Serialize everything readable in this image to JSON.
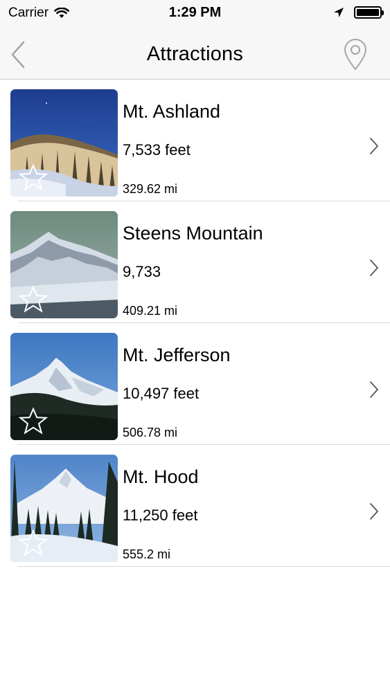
{
  "status_bar": {
    "carrier": "Carrier",
    "time": "1:29 PM"
  },
  "nav": {
    "title": "Attractions",
    "back_icon": "chevron-left-icon",
    "map_icon": "map-pin-icon",
    "tint_color": "#a6a6a6"
  },
  "attractions": [
    {
      "name": "Mt. Ashland",
      "elevation": "7,533 feet",
      "distance": "329.62 mi",
      "favorite": false
    },
    {
      "name": "Steens Mountain",
      "elevation": "9,733",
      "distance": "409.21 mi",
      "favorite": false
    },
    {
      "name": "Mt. Jefferson",
      "elevation": "10,497 feet",
      "distance": "506.78 mi",
      "favorite": false
    },
    {
      "name": "Mt. Hood",
      "elevation": "11,250 feet",
      "distance": "555.2 mi",
      "favorite": false
    }
  ],
  "icons": {
    "favorite": "star-outline-icon",
    "disclosure": "chevron-right-icon"
  }
}
